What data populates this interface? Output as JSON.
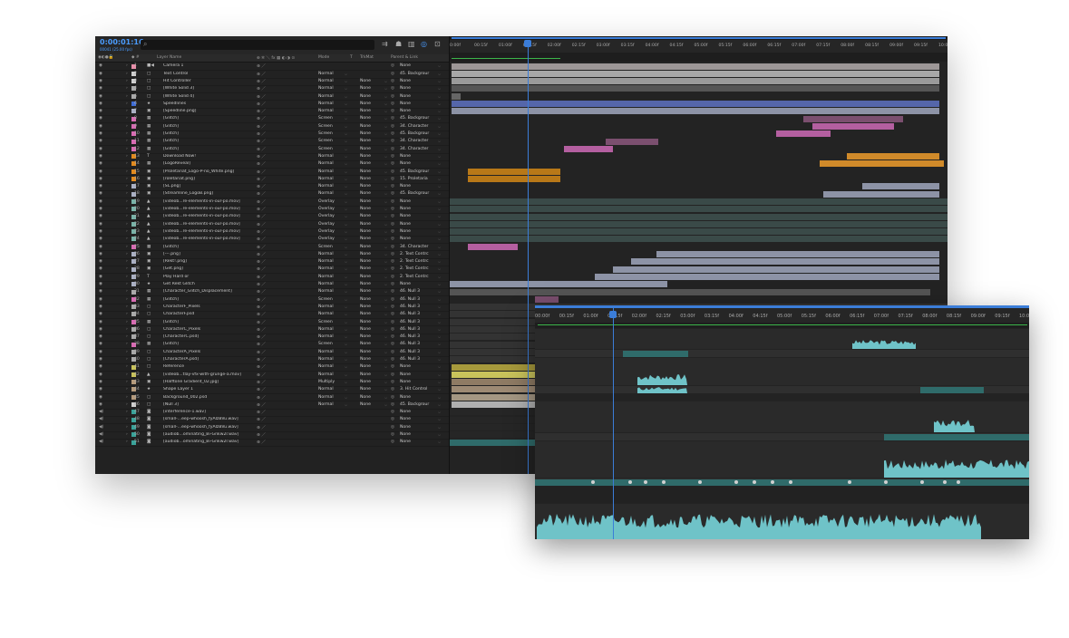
{
  "timecode": "0:00:01:16",
  "timecode_sub": "00041 (25.00 fps)",
  "search": {
    "placeholder": ""
  },
  "icons": {
    "search": "search-icon",
    "tools": [
      "comp-flowchart-icon",
      "shy-icon",
      "frame-blend-icon",
      "motion-blur-icon",
      "graph-editor-icon"
    ],
    "eye": "eye-icon",
    "speaker": "speaker-icon",
    "expand": "chevron-right-icon",
    "dropdown": "chevron-down-icon",
    "parent": "pickwhip-icon"
  },
  "columns": {
    "label": "Layer Name",
    "mode": "Mode",
    "t": "T",
    "trkmat": "TrkMat",
    "parent": "Parent & Link"
  },
  "ruler": [
    "0:00f",
    "00:15f",
    "01:00f",
    "01:15f",
    "02:00f",
    "02:15f",
    "03:00f",
    "03:15f",
    "04:00f",
    "04:15f",
    "05:00f",
    "05:15f",
    "06:00f",
    "06:15f",
    "07:00f",
    "07:15f",
    "08:00f",
    "08:15f",
    "09:00f",
    "09:15f",
    "10:0"
  ],
  "layers": [
    {
      "num": "1",
      "type": "■◀",
      "name": "Camera 1",
      "mode": "",
      "trk": "",
      "parent": "None",
      "color": "#e88ea9",
      "audio": false
    },
    {
      "num": "2",
      "type": "□",
      "name": "Text Control",
      "mode": "Normal",
      "trk": "",
      "parent": "45. Backgrour",
      "color": "#cfcfcf",
      "audio": false
    },
    {
      "num": "3",
      "type": "□",
      "name": "Hit Controller",
      "mode": "Normal",
      "trk": "None",
      "parent": "None",
      "color": "#cfcfcf",
      "audio": false
    },
    {
      "num": "4",
      "type": "□",
      "name": "[White Solid 3]",
      "mode": "Normal",
      "trk": "None",
      "parent": "None",
      "color": "#aaaaaa",
      "audio": false
    },
    {
      "num": "5",
      "type": "□",
      "name": "[White Solid 4]",
      "mode": "Normal",
      "trk": "None",
      "parent": "None",
      "color": "#aaaaaa",
      "audio": false
    },
    {
      "num": "6",
      "type": "★",
      "name": "Speedlines",
      "mode": "Normal",
      "trk": "None",
      "parent": "None",
      "color": "#3f6dd6",
      "audio": false
    },
    {
      "num": "7",
      "type": "▣",
      "name": "[Speedline.png]",
      "mode": "Normal",
      "trk": "None",
      "parent": "None",
      "color": "#aab0c4",
      "audio": false
    },
    {
      "num": "8",
      "type": "▦",
      "name": "[Glitch]",
      "mode": "Screen",
      "trk": "None",
      "parent": "45. Backgrour",
      "color": "#d86bb3",
      "audio": false
    },
    {
      "num": "9",
      "type": "▦",
      "name": "[Glitch]",
      "mode": "Screen",
      "trk": "None",
      "parent": "34. Character",
      "color": "#d86bb3",
      "audio": false
    },
    {
      "num": "10",
      "type": "▦",
      "name": "[Glitch]",
      "mode": "Screen",
      "trk": "None",
      "parent": "45. Backgrour",
      "color": "#d86bb3",
      "audio": false
    },
    {
      "num": "11",
      "type": "▦",
      "name": "[Glitch]",
      "mode": "Screen",
      "trk": "None",
      "parent": "34. Character",
      "color": "#d86bb3",
      "audio": false
    },
    {
      "num": "12",
      "type": "▦",
      "name": "[Glitch]",
      "mode": "Screen",
      "trk": "None",
      "parent": "34. Character",
      "color": "#d86bb3",
      "audio": false
    },
    {
      "num": "13",
      "type": "T",
      "name": "Download Now!",
      "mode": "Normal",
      "trk": "None",
      "parent": "None",
      "color": "#e28a1e",
      "audio": false
    },
    {
      "num": "14",
      "type": "▦",
      "name": "[LogoReveal]",
      "mode": "Normal",
      "trk": "None",
      "parent": "None",
      "color": "#e28a1e",
      "audio": false
    },
    {
      "num": "15",
      "type": "▣",
      "name": "[Proletariat_Logo-P-no_White.png]",
      "mode": "Normal",
      "trk": "None",
      "parent": "45. Backgrour",
      "color": "#e28a1e",
      "audio": false
    },
    {
      "num": "16",
      "type": "▣",
      "name": "[roletariat.png]",
      "mode": "Normal",
      "trk": "None",
      "parent": "15. Proletaria",
      "color": "#e28a1e",
      "audio": false
    },
    {
      "num": "17",
      "type": "▣",
      "name": "[SL.png]",
      "mode": "Normal",
      "trk": "None",
      "parent": "None",
      "color": "#aab0c4",
      "audio": false
    },
    {
      "num": "18",
      "type": "▣",
      "name": "[Streamline_LogoB.png]",
      "mode": "Normal",
      "trk": "None",
      "parent": "45. Backgrour",
      "color": "#aab0c4",
      "audio": false
    },
    {
      "num": "19",
      "type": "▲",
      "name": "[videob...re-elements-in-our-po.mov]",
      "mode": "Overlay",
      "trk": "None",
      "parent": "None",
      "color": "#79b3a8",
      "audio": false
    },
    {
      "num": "20",
      "type": "▲",
      "name": "[videob...re-elements-in-our-po.mov]",
      "mode": "Overlay",
      "trk": "None",
      "parent": "None",
      "color": "#79b3a8",
      "audio": false
    },
    {
      "num": "21",
      "type": "▲",
      "name": "[videob...re-elements-in-our-po.mov]",
      "mode": "Overlay",
      "trk": "None",
      "parent": "None",
      "color": "#79b3a8",
      "audio": false
    },
    {
      "num": "22",
      "type": "▲",
      "name": "[videob...re-elements-in-our-po.mov]",
      "mode": "Overlay",
      "trk": "None",
      "parent": "None",
      "color": "#79b3a8",
      "audio": false
    },
    {
      "num": "23",
      "type": "▲",
      "name": "[videob...re-elements-in-our-po.mov]",
      "mode": "Overlay",
      "trk": "None",
      "parent": "None",
      "color": "#79b3a8",
      "audio": false
    },
    {
      "num": "24",
      "type": "▲",
      "name": "[videob...re-elements-in-our-po.mov]",
      "mode": "Overlay",
      "trk": "None",
      "parent": "None",
      "color": "#79b3a8",
      "audio": false
    },
    {
      "num": "25",
      "type": "▦",
      "name": "[Glitch]",
      "mode": "Screen",
      "trk": "None",
      "parent": "34. Character",
      "color": "#d86bb3",
      "audio": false
    },
    {
      "num": "26",
      "type": "▣",
      "name": "[---.png]",
      "mode": "Normal",
      "trk": "None",
      "parent": "2. Text Contrc",
      "color": "#aab0c4",
      "audio": false
    },
    {
      "num": "27",
      "type": "▣",
      "name": "[Rekt!.png]",
      "mode": "Normal",
      "trk": "None",
      "parent": "2. Text Contrc",
      "color": "#aab0c4",
      "audio": false
    },
    {
      "num": "28",
      "type": "▣",
      "name": "[Get.png]",
      "mode": "Normal",
      "trk": "None",
      "parent": "2. Text Contrc",
      "color": "#aab0c4",
      "audio": false
    },
    {
      "num": "29",
      "type": "T",
      "name": "Play Hard or",
      "mode": "Normal",
      "trk": "None",
      "parent": "2. Text Contrc",
      "color": "#aab0c4",
      "audio": false
    },
    {
      "num": "30",
      "type": "★",
      "name": "Get Rekt Glitch",
      "mode": "Normal",
      "trk": "None",
      "parent": "None",
      "color": "#aab0c4",
      "audio": false
    },
    {
      "num": "31",
      "type": "▦",
      "name": "[Character_Glitch_Displacement]",
      "mode": "Normal",
      "trk": "None",
      "parent": "46. Null 3",
      "color": "#aaaaaa",
      "audio": false
    },
    {
      "num": "32",
      "type": "▦",
      "name": "[Glitch]",
      "mode": "Screen",
      "trk": "None",
      "parent": "46. Null 3",
      "color": "#d86bb3",
      "audio": false
    },
    {
      "num": "33",
      "type": "▢",
      "name": "CharacterF_Pixels",
      "mode": "Normal",
      "trk": "None",
      "parent": "46. Null 3",
      "color": "#aaaaaa",
      "audio": false
    },
    {
      "num": "34",
      "type": "▢",
      "name": "CharacterF.psd",
      "mode": "Normal",
      "trk": "None",
      "parent": "46. Null 3",
      "color": "#aaaaaa",
      "audio": false
    },
    {
      "num": "35",
      "type": "▦",
      "name": "[Glitch]",
      "mode": "Screen",
      "trk": "None",
      "parent": "46. Null 3",
      "color": "#d86bb3",
      "audio": false
    },
    {
      "num": "36",
      "type": "▢",
      "name": "CharacterC_Pixels",
      "mode": "Normal",
      "trk": "None",
      "parent": "46. Null 3",
      "color": "#aaaaaa",
      "audio": false
    },
    {
      "num": "37",
      "type": "▢",
      "name": "[CharacterC.psd]",
      "mode": "Normal",
      "trk": "None",
      "parent": "46. Null 3",
      "color": "#aaaaaa",
      "audio": false
    },
    {
      "num": "38",
      "type": "▦",
      "name": "[Glitch]",
      "mode": "Screen",
      "trk": "None",
      "parent": "46. Null 3",
      "color": "#d86bb3",
      "audio": false
    },
    {
      "num": "39",
      "type": "▢",
      "name": "CharacterA_Pixels",
      "mode": "Normal",
      "trk": "None",
      "parent": "46. Null 3",
      "color": "#aaaaaa",
      "audio": false
    },
    {
      "num": "40",
      "type": "▢",
      "name": "[CharacterA.psd]",
      "mode": "Normal",
      "trk": "None",
      "parent": "46. Null 3",
      "color": "#aaaaaa",
      "audio": false
    },
    {
      "num": "41",
      "type": "□",
      "name": "Reference",
      "mode": "Normal",
      "trk": "None",
      "parent": "None",
      "color": "#c9c35b",
      "audio": false
    },
    {
      "num": "42",
      "type": "▲",
      "name": "[videob...tlay-vfx-with-grunge-a.mov]",
      "mode": "Normal",
      "trk": "None",
      "parent": "None",
      "color": "#c9c35b",
      "audio": false
    },
    {
      "num": "43",
      "type": "▣",
      "name": "[Halftone Gradient_02.jpg]",
      "mode": "Multiply",
      "trk": "None",
      "parent": "None",
      "color": "#b59a7b",
      "audio": false
    },
    {
      "num": "44",
      "type": "★",
      "name": "Shape Layer 1",
      "mode": "Normal",
      "trk": "None",
      "parent": "3. Hit Control",
      "color": "#b59a7b",
      "audio": false
    },
    {
      "num": "45",
      "type": "▢",
      "name": "Background_002.psd",
      "mode": "Normal",
      "trk": "None",
      "parent": "None",
      "color": "#b59a7b",
      "audio": false
    },
    {
      "num": "46",
      "type": "□",
      "name": "[Null 3]",
      "mode": "Normal",
      "trk": "None",
      "parent": "45. Backgrour",
      "color": "#cfcfcf",
      "audio": false
    },
    {
      "num": "47",
      "type": "◙",
      "name": "[interference-1.wav]",
      "mode": "",
      "trk": "",
      "parent": "None",
      "color": "#3aa39a",
      "audio": true
    },
    {
      "num": "48",
      "type": "◙",
      "name": "[small-...eep-whoosh_fyAIzBVu.wav]",
      "mode": "",
      "trk": "",
      "parent": "None",
      "color": "#3aa39a",
      "audio": true
    },
    {
      "num": "49",
      "type": "◙",
      "name": "[small-...eep-whoosh_fyAIzBVu.wav]",
      "mode": "",
      "trk": "",
      "parent": "None",
      "color": "#3aa39a",
      "audio": true
    },
    {
      "num": "50",
      "type": "◙",
      "name": "[audiob...ominating_Bi-Gnkw2r.wav]",
      "mode": "",
      "trk": "",
      "parent": "None",
      "color": "#3aa39a",
      "audio": true
    },
    {
      "num": "51",
      "type": "◙",
      "name": "[audiob...ominating_Bi-Gnkw2r.wav]",
      "mode": "",
      "trk": "",
      "parent": "None",
      "color": "#3aa39a",
      "audio": true
    }
  ],
  "zoom_ruler": [
    "00:00f",
    "00:15f",
    "01:00f",
    "01:15f",
    "02:00f",
    "02:15f",
    "03:00f",
    "03:15f",
    "04:00f",
    "04:15f",
    "05:00f",
    "05:15f",
    "06:00f",
    "06:15f",
    "07:00f",
    "07:15f",
    "08:00f",
    "08:15f",
    "09:00f",
    "09:15f",
    "10:0"
  ]
}
